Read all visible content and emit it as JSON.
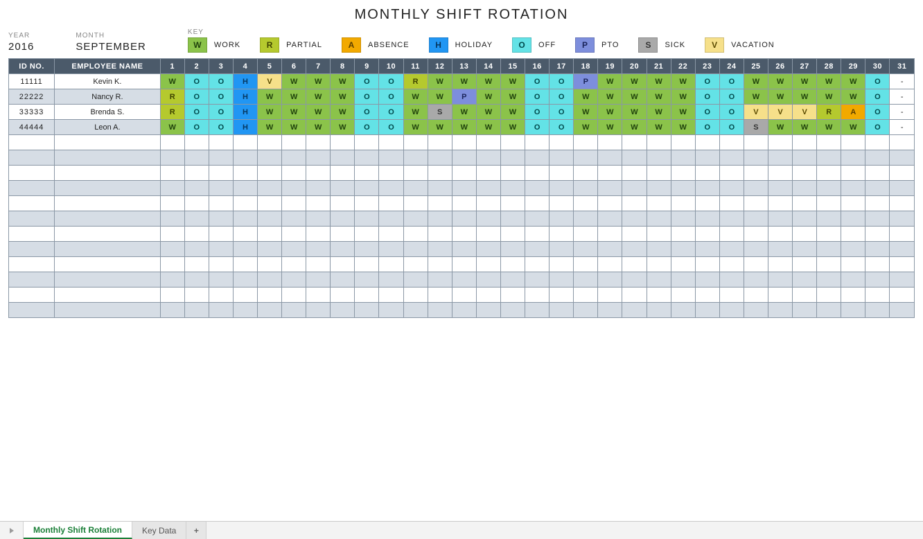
{
  "title": "MONTHLY SHIFT ROTATION",
  "meta": {
    "year_label": "YEAR",
    "year": "2016",
    "month_label": "MONTH",
    "month": "SEPTEMBER",
    "key_label": "KEY"
  },
  "key": [
    {
      "code": "W",
      "label": "WORK",
      "class": "c-W"
    },
    {
      "code": "R",
      "label": "PARTIAL",
      "class": "c-R"
    },
    {
      "code": "A",
      "label": "ABSENCE",
      "class": "c-A"
    },
    {
      "code": "H",
      "label": "HOLIDAY",
      "class": "c-H"
    },
    {
      "code": "O",
      "label": "OFF",
      "class": "c-O"
    },
    {
      "code": "P",
      "label": "PTO",
      "class": "c-P"
    },
    {
      "code": "S",
      "label": "SICK",
      "class": "c-S"
    },
    {
      "code": "V",
      "label": "VACATION",
      "class": "c-V"
    }
  ],
  "grid": {
    "headers": {
      "id": "ID NO.",
      "name": "EMPLOYEE NAME"
    },
    "days": [
      "1",
      "2",
      "3",
      "4",
      "5",
      "6",
      "7",
      "8",
      "9",
      "10",
      "11",
      "12",
      "13",
      "14",
      "15",
      "16",
      "17",
      "18",
      "19",
      "20",
      "21",
      "22",
      "23",
      "24",
      "25",
      "26",
      "27",
      "28",
      "29",
      "30",
      "31"
    ],
    "rows": [
      {
        "id": "11111",
        "name": "Kevin K.",
        "shifts": [
          "W",
          "O",
          "O",
          "H",
          "V",
          "W",
          "W",
          "W",
          "O",
          "O",
          "R",
          "W",
          "W",
          "W",
          "W",
          "O",
          "O",
          "P",
          "W",
          "W",
          "W",
          "W",
          "O",
          "O",
          "W",
          "W",
          "W",
          "W",
          "W",
          "O",
          "-"
        ]
      },
      {
        "id": "22222",
        "name": "Nancy R.",
        "shifts": [
          "R",
          "O",
          "O",
          "H",
          "W",
          "W",
          "W",
          "W",
          "O",
          "O",
          "W",
          "W",
          "P",
          "W",
          "W",
          "O",
          "O",
          "W",
          "W",
          "W",
          "W",
          "W",
          "O",
          "O",
          "W",
          "W",
          "W",
          "W",
          "W",
          "O",
          "-"
        ]
      },
      {
        "id": "33333",
        "name": "Brenda S.",
        "shifts": [
          "R",
          "O",
          "O",
          "H",
          "W",
          "W",
          "W",
          "W",
          "O",
          "O",
          "W",
          "S",
          "W",
          "W",
          "W",
          "O",
          "O",
          "W",
          "W",
          "W",
          "W",
          "W",
          "O",
          "O",
          "V",
          "V",
          "V",
          "R",
          "A",
          "O",
          "-"
        ]
      },
      {
        "id": "44444",
        "name": "Leon A.",
        "shifts": [
          "W",
          "O",
          "O",
          "H",
          "W",
          "W",
          "W",
          "W",
          "O",
          "O",
          "W",
          "W",
          "W",
          "W",
          "W",
          "O",
          "O",
          "W",
          "W",
          "W",
          "W",
          "W",
          "O",
          "O",
          "S",
          "W",
          "W",
          "W",
          "W",
          "O",
          "-"
        ]
      }
    ],
    "empty_rows": 12
  },
  "tabs": {
    "active": "Monthly Shift Rotation",
    "other": "Key Data",
    "add": "+"
  }
}
